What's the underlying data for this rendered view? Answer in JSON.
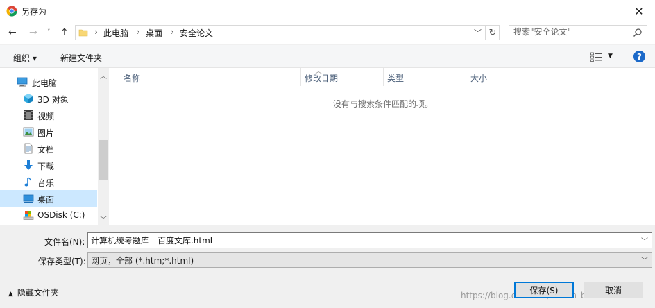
{
  "window": {
    "title": "另存为"
  },
  "nav": {
    "back_icon": "←",
    "forward_icon": "→",
    "recent_icon": "˅",
    "up_icon": "↑"
  },
  "address": {
    "crumbs": [
      "此电脑",
      "桌面",
      "安全论文"
    ],
    "separator": "›"
  },
  "search": {
    "placeholder": "搜索\"安全论文\""
  },
  "toolbar": {
    "organize_label": "组织 ▾",
    "new_folder_label": "新建文件夹",
    "help_label": "?"
  },
  "nav_tree": [
    {
      "label": "此电脑",
      "icon": "computer-icon"
    },
    {
      "label": "3D 对象",
      "icon": "3d-objects-icon"
    },
    {
      "label": "视频",
      "icon": "video-icon"
    },
    {
      "label": "图片",
      "icon": "pictures-icon"
    },
    {
      "label": "文档",
      "icon": "documents-icon"
    },
    {
      "label": "下载",
      "icon": "download-icon"
    },
    {
      "label": "音乐",
      "icon": "music-icon"
    },
    {
      "label": "桌面",
      "icon": "desktop-icon",
      "selected": true
    },
    {
      "label": "OSDisk (C:)",
      "icon": "drive-icon"
    }
  ],
  "columns": {
    "name": "名称",
    "modified": "修改日期",
    "type": "类型",
    "size": "大小"
  },
  "file_list": {
    "empty_message": "没有与搜索条件匹配的项。"
  },
  "form": {
    "filename_label": "文件名(N):",
    "filename_value": "计算机统考题库 - 百度文库.html",
    "filetype_label": "保存类型(T):",
    "filetype_value": "网页，全部 (*.htm;*.html)"
  },
  "footer": {
    "hide_folders_label": "隐藏文件夹",
    "save_label": "保存(S)",
    "cancel_label": "取消",
    "watermark": "https://blog.csdn.net/weixin_belbai_belbai"
  },
  "colors": {
    "selection": "#cce8ff",
    "accent": "#0078d7",
    "help": "#1b69c9"
  }
}
